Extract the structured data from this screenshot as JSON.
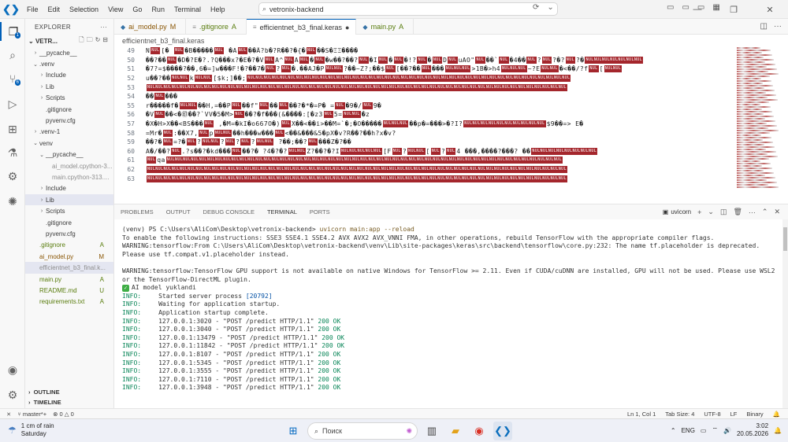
{
  "titlebar": {
    "menu": [
      "File",
      "Edit",
      "Selection",
      "View",
      "Go",
      "Run",
      "Terminal",
      "Help"
    ],
    "search_value": "vetronix-backend"
  },
  "sidebar": {
    "title": "EXPLORER",
    "workspace": "VETR...",
    "tree": [
      {
        "label": "__pycache__",
        "indent": 1,
        "chev": "›",
        "cls": ""
      },
      {
        "label": ".venv",
        "indent": 1,
        "chev": "⌄",
        "cls": ""
      },
      {
        "label": "Include",
        "indent": 2,
        "chev": "›",
        "cls": ""
      },
      {
        "label": "Lib",
        "indent": 2,
        "chev": "›",
        "cls": ""
      },
      {
        "label": "Scripts",
        "indent": 2,
        "chev": "›",
        "cls": ""
      },
      {
        "label": ".gitignore",
        "indent": 2,
        "chev": "",
        "cls": ""
      },
      {
        "label": "pyvenv.cfg",
        "indent": 2,
        "chev": "",
        "cls": ""
      },
      {
        "label": ".venv-1",
        "indent": 1,
        "chev": "›",
        "cls": ""
      },
      {
        "label": "venv",
        "indent": 1,
        "chev": "⌄",
        "cls": ""
      },
      {
        "label": "__pycache__",
        "indent": 2,
        "chev": "⌄",
        "cls": ""
      },
      {
        "label": "ai_model.cpython-3...",
        "indent": 3,
        "chev": "",
        "cls": "greyed"
      },
      {
        "label": "main.cpython-313....",
        "indent": 3,
        "chev": "",
        "cls": "greyed"
      },
      {
        "label": "Include",
        "indent": 2,
        "chev": "›",
        "cls": ""
      },
      {
        "label": "Lib",
        "indent": 2,
        "chev": "›",
        "cls": "sel"
      },
      {
        "label": "Scripts",
        "indent": 2,
        "chev": "›",
        "cls": ""
      },
      {
        "label": ".gitignore",
        "indent": 2,
        "chev": "",
        "cls": ""
      },
      {
        "label": "pyvenv.cfg",
        "indent": 2,
        "chev": "",
        "cls": ""
      },
      {
        "label": ".gitignore",
        "indent": 1,
        "chev": "",
        "cls": "git-a",
        "badge": "A"
      },
      {
        "label": "ai_model.py",
        "indent": 1,
        "chev": "",
        "cls": "git-m",
        "badge": "M"
      },
      {
        "label": "efficientnet_b3_final.k...",
        "indent": 1,
        "chev": "",
        "cls": "greyed sel"
      },
      {
        "label": "main.py",
        "indent": 1,
        "chev": "",
        "cls": "git-a",
        "badge": "A"
      },
      {
        "label": "README.md",
        "indent": 1,
        "chev": "",
        "cls": "git-u",
        "badge": "U"
      },
      {
        "label": "requirements.txt",
        "indent": 1,
        "chev": "",
        "cls": "git-a",
        "badge": "A"
      }
    ],
    "outline": "OUTLINE",
    "timeline": "TIMELINE"
  },
  "tabs": [
    {
      "label": "ai_model.py",
      "status": "M",
      "active": false
    },
    {
      "label": ".gitignore",
      "status": "A",
      "active": false
    },
    {
      "label": "efficientnet_b3_final.keras",
      "status": "",
      "active": true
    },
    {
      "label": "main.py",
      "status": "A",
      "active": false
    }
  ],
  "breadcrumb": "efficientnet_b3_final.keras",
  "editor": {
    "lines": [
      {
        "n": "49",
        "t": "N@[�   @�B�����@  �A@��Ã?b�?R��?�{�@��S�ΞΞ����"
      },
      {
        "n": "50",
        "t": "��?��@�D�?E�?.?Q���x?�E�?�V@A^@A@�@�w��?��?@@�I@�@�!?@@�@@D@uAO\"@��`@�4��@?@?�?@@?�@@@@@@@@@@@@@"
      },
      {
        "n": "51",
        "t": "�7?=$����?��,6�=]w���F!�?��7�@?@�.��AJ�P@@@?��~Z?;��$@[��?��@���@@@@@>1B�>h4@@@@@~?E@@@�<��/?f@@[@@@"
      },
      {
        "n": "52",
        "t": "u��?��@@@k@@@[$k;]��;@@@@@@@@@@@@@@@@@@@@@@@@@@@@@@@@@@@@@@@@@@@@@@@@@@@@@@@@@@@@@@@@@@@@@@@@@@@@@@@"
      },
      {
        "n": "53",
        "t": "@@@@@@@@@@@@@@@@@@@@@@@@@@@@@@@@@@@@@@@@@@@@@@@@@@@@@@@@@@@@@@@@@@@@@@@@@@@@@@@@@@@@@@@@@@@@@@@@@@@@@@@@"
      },
      {
        "n": "54",
        "t": "��@@���"
      },
      {
        "n": "55",
        "t": "r�����f�@@@��H,=��P@@��f\"@��@@��?�*�=P�   =@�9�/@@9�"
      },
      {
        "n": "56",
        "t": "�V@@��<�㊞��?`VV�5�M>@��?�f���(&����:[�z3@@5=@@@@�z"
      },
      {
        "n": "57",
        "t": "�X�H>X��<BS���@ ,�M=�kI�o667O�)@@X��<��i>��M=`�;�O�����@@@@@@��p�=���>�?I?@@@@@@@@@@@@@@@@@@@$9��=> E�"
      },
      {
        "n": "58",
        "t": "=Mr�@:��X7,@p@@@��h���w���@<��&���&5�pX�v?R��?��h?x�v?"
      },
      {
        "n": "59",
        "t": "��?�@=?�@@?@@@?@?@@?@@@ ?��;��?@@���Z�?��"
      },
      {
        "n": "60",
        "t": "A�/��?@.?s��?�kd���@@��?� ?4�?�?@@@@Z?��?�?I@@@@@@@@@[F@?@@@[@?@4    ���,����?���? ��@@@@@@@@@@@@@@@@"
      },
      {
        "n": "61",
        "t": "@qa@@@@@@@@@@@@@@@@@@@@@@@@@@@@@@@@@@@@@@@@@@@@@@@@@@@@@@@@@@@@@@@@@@@@@@@@@@@@@@@@@@@@@@@@@@@@@@@@@"
      },
      {
        "n": "62",
        "t": "@@@@@@@@@@@@@@@@@@@@@@@@@@@@@@@@@@@@@@@@@@@@@@@@@@@@@@@@@@@@@@@@@@@@@@@@@@@@@@@@@@@@@@@@@@@@@@@@@@@@@@@"
      },
      {
        "n": "63",
        "t": "@@@@@@@@@@@@@@@@@@@@@@@@@@@@@@@@@@@@@@@@@@@@@@@@@@@@@@@@@@@@@@@@@@@@@@@@@@@@@@@@@@@@@@@@@@@@@@@@@@@@@@@"
      }
    ]
  },
  "panel": {
    "tabs": [
      "PROBLEMS",
      "OUTPUT",
      "DEBUG CONSOLE",
      "TERMINAL",
      "PORTS"
    ],
    "active_tab": "TERMINAL",
    "terminal_name": "uvicorn"
  },
  "terminal": {
    "prompt": "(venv) PS C:\\Users\\AliCom\\Desktop\\vetronix-backend> ",
    "command": "uvicorn main:app --reload",
    "lines": [
      "To enable the following instructions: SSE3 SSE4.1 SSE4.2 AVX AVX2 AVX_VNNI FMA, in other operations, rebuild TensorFlow with the appropriate compiler flags.",
      "WARNING:tensorflow:From C:\\Users\\AliCom\\Desktop\\vetronix-backend\\venv\\Lib\\site-packages\\keras\\src\\backend\\tensorflow\\core.py:232: The name tf.placeholder is deprecated. Please use tf.compat.v1.placeholder instead.",
      "",
      "WARNING:tensorflow:TensorFlow GPU support is not available on native Windows for TensorFlow >= 2.11. Even if CUDA/cuDNN are installed, GPU will not be used. Please use WSL2 or the TensorFlow-DirectML plugin."
    ],
    "model_loaded": "AI model yuklandi",
    "info_label": "INFO:",
    "server_started": "Started server process",
    "pid": "[20792]",
    "waiting": "Waiting for application startup.",
    "complete": "Application startup complete.",
    "requests": [
      {
        "ip": "127.0.0.1:3020",
        "req": "\"POST /predict HTTP/1.1\"",
        "code": "200 OK"
      },
      {
        "ip": "127.0.0.1:3040",
        "req": "\"POST /predict HTTP/1.1\"",
        "code": "200 OK"
      },
      {
        "ip": "127.0.0.1:13479",
        "req": "\"POST /predict HTTP/1.1\"",
        "code": "200 OK"
      },
      {
        "ip": "127.0.0.1:11842",
        "req": "\"POST /predict HTTP/1.1\"",
        "code": "200 OK"
      },
      {
        "ip": "127.0.0.1:8107",
        "req": "\"POST /predict HTTP/1.1\"",
        "code": "200 OK"
      },
      {
        "ip": "127.0.0.1:5345",
        "req": "\"POST /predict HTTP/1.1\"",
        "code": "200 OK"
      },
      {
        "ip": "127.0.0.1:3555",
        "req": "\"POST /predict HTTP/1.1\"",
        "code": "200 OK"
      },
      {
        "ip": "127.0.0.1:7110",
        "req": "\"POST /predict HTTP/1.1\"",
        "code": "200 OK"
      },
      {
        "ip": "127.0.0.1:3948",
        "req": "\"POST /predict HTTP/1.1\"",
        "code": "200 OK"
      }
    ]
  },
  "statusbar": {
    "branch": "master*+",
    "errors": "⊗ 0 △ 0",
    "position": "Ln 1, Col 1",
    "tab_size": "Tab Size: 4",
    "encoding": "UTF-8",
    "eol": "LF",
    "lang": "Binary"
  },
  "taskbar": {
    "weather_temp": "1 cm of rain",
    "weather_day": "Saturday",
    "search": "Поиск",
    "lang": "ENG",
    "time": "3:02",
    "date": "20.05.2026"
  },
  "colors": {
    "accent": "#005fb8",
    "error_block": "#a4262c",
    "ok": "#098658"
  }
}
